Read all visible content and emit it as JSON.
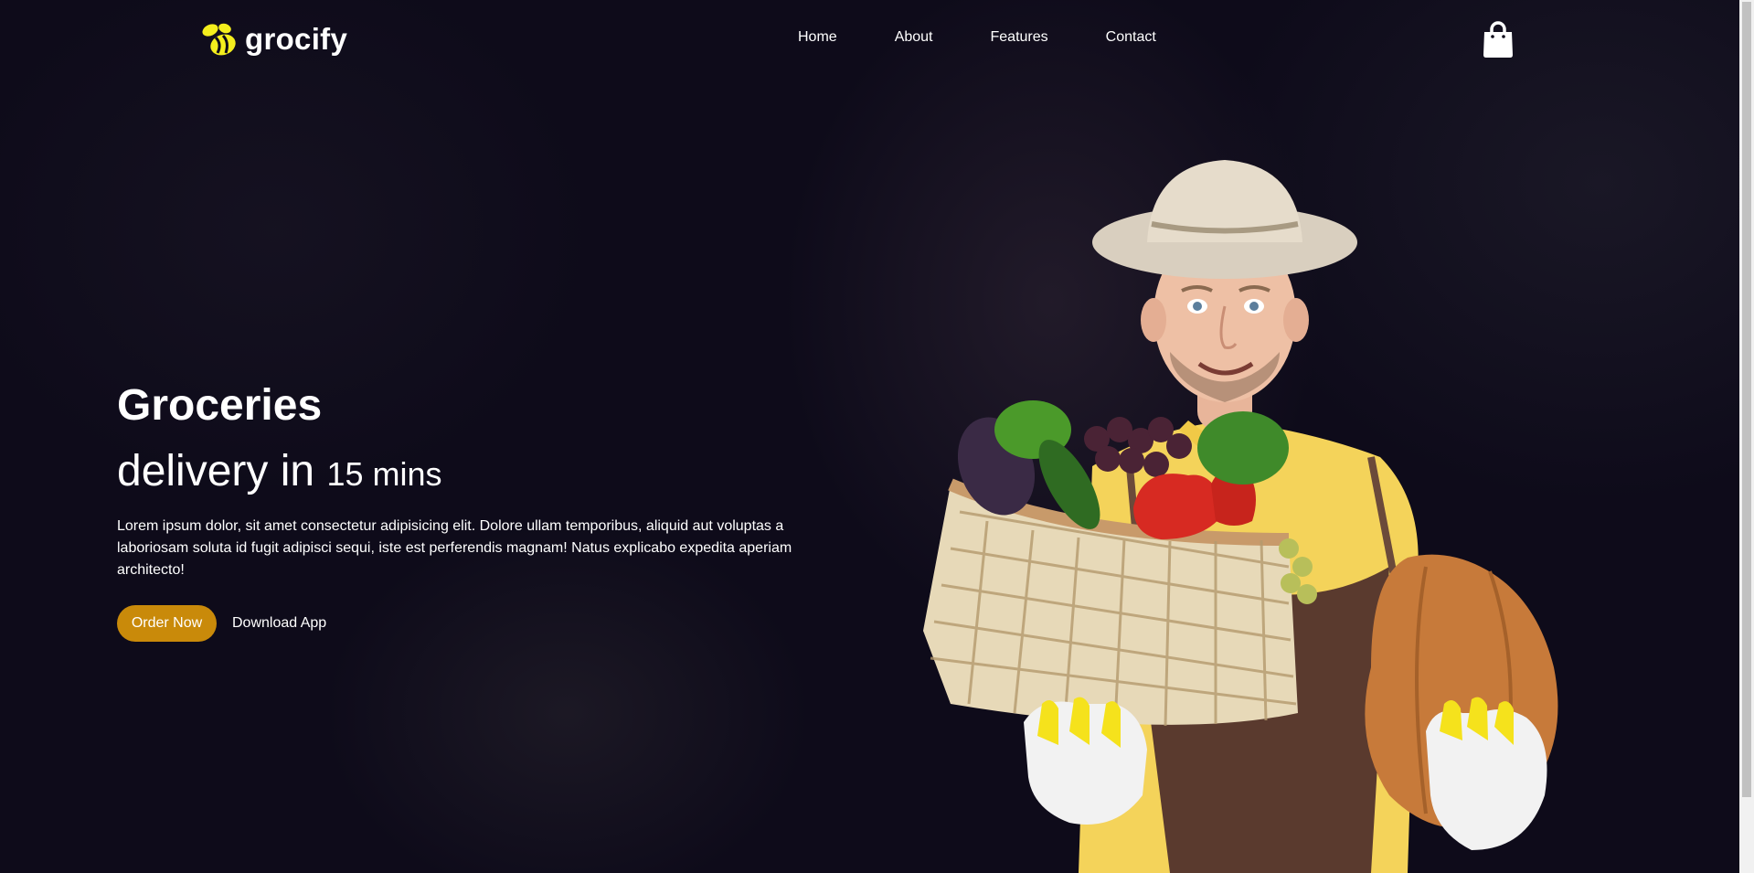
{
  "brand": {
    "name": "grocify",
    "logo_icon": "bee-icon",
    "accent": "#f4ee1d"
  },
  "nav": {
    "items": [
      {
        "label": "Home"
      },
      {
        "label": "About"
      },
      {
        "label": "Features"
      },
      {
        "label": "Contact"
      }
    ]
  },
  "header": {
    "cart_icon": "shopping-bag-icon"
  },
  "hero": {
    "title": "Groceries",
    "subtitle_main": "delivery in",
    "subtitle_small": "15 mins",
    "description": "Lorem ipsum dolor, sit amet consectetur adipisicing elit. Dolore ullam temporibus, aliquid aut voluptas a laboriosam soluta id fugit adipisci sequi, iste est perferendis magnam! Natus explicabo expedita aperiam architecto!",
    "primary_button": "Order Now",
    "secondary_button": "Download App",
    "primary_color": "#c98a0a",
    "image": "farmer-with-vegetable-basket"
  }
}
